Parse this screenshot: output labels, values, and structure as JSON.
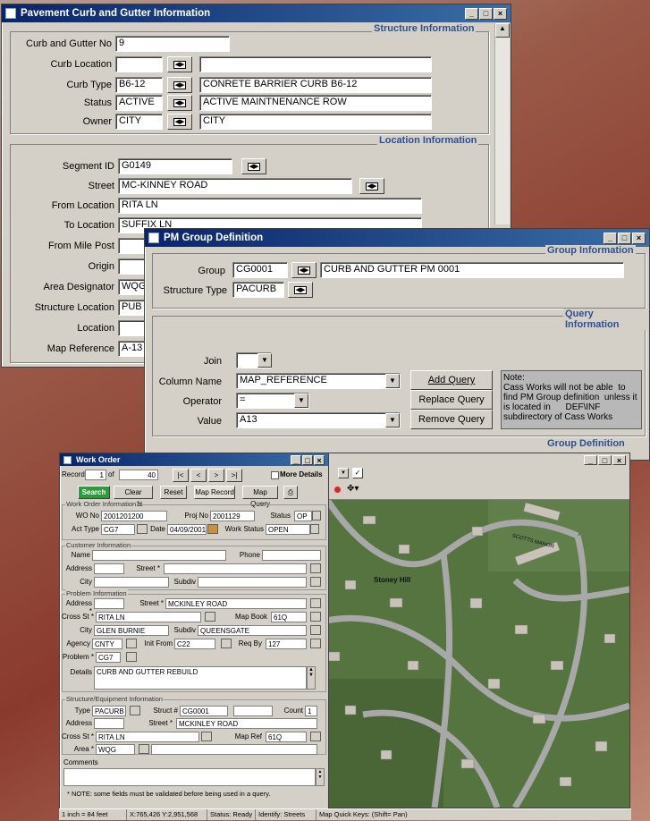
{
  "curb": {
    "title": "Pavement Curb and Gutter Information",
    "structure_info": "Structure Information",
    "location_info": "Location Information",
    "curb_gutter_no_label": "Curb and Gutter No",
    "curb_gutter_no": "9",
    "curb_location_label": "Curb Location",
    "curb_location": "",
    "curb_location_desc": "",
    "curb_type_label": "Curb Type",
    "curb_type": "B6-12",
    "curb_type_desc": "CONRETE BARRIER CURB B6-12",
    "status_label": "Status",
    "status": "ACTIVE",
    "status_desc": "ACTIVE MAINTNENANCE ROW",
    "owner_label": "Owner",
    "owner": "CITY",
    "owner_desc": "CITY",
    "segment_id_label": "Segment ID",
    "segment_id": "G0149",
    "street_label": "Street",
    "street": "MC-KINNEY ROAD",
    "from_location_label": "From Location",
    "from_location": "RITA LN",
    "to_location_label": "To Location",
    "to_location": "SUFFIX LN",
    "from_mile_post_label": "From Mile Post",
    "from_mile_post": "",
    "origin_label": "Origin",
    "origin": "",
    "area_designator_label": "Area Designator",
    "area_designator": "WQG",
    "structure_location_label": "Structure Location",
    "structure_location": "PUB",
    "location_label": "Location",
    "location": "",
    "map_reference_label": "Map Reference",
    "map_reference": "A-13"
  },
  "pm": {
    "title": "PM Group Definition",
    "group_info": "Group Information",
    "query_info": "Query Information",
    "group_def": "Group Definition",
    "group_label": "Group",
    "group": "CG0001",
    "group_desc": "CURB AND GUTTER PM 0001",
    "structure_type_label": "Structure Type",
    "structure_type": "PACURB",
    "join_label": "Join",
    "join": "",
    "column_name_label": "Column Name",
    "column_name": "MAP_REFERENCE",
    "operator_label": "Operator",
    "operator": "=",
    "value_label": "Value",
    "value": "A13",
    "add_query": "Add Query",
    "replace_query": "Replace Query",
    "remove_query": "Remove Query",
    "note": "Note:\nCass Works will not be able  to find PM Group definition  unless it is located in      DEF\\INF subdirectory of Cass Works"
  },
  "wo": {
    "title": "Work Order",
    "record_label": "Record",
    "record": "1",
    "of_label": "of",
    "record_total": "40",
    "nav": [
      "|<",
      "<",
      ">",
      ">|"
    ],
    "more_details": "More Details",
    "search": "Search",
    "clear_fields": "Clear Fields",
    "reset": "Reset",
    "map_record": "Map Record",
    "map_query": "Map Query",
    "sec_wo_info": "Work Order Information",
    "wo_no_label": "WO No",
    "wo_no": "2001201200",
    "proj_no_label": "Proj No",
    "proj_no": "2001129",
    "status_label": "Status",
    "status": "OP",
    "act_type_label": "Act Type",
    "act_type": "CG7",
    "date_label": "Date",
    "date": "04/09/2001",
    "work_status_label": "Work Status",
    "work_status": "OPEN",
    "sec_customer": "Customer Information",
    "name_label": "Name",
    "phone_label": "Phone",
    "address_label": "Address",
    "street_label": "Street *",
    "city_label": "City",
    "subdiv_label": "Subdiv",
    "sec_problem": "Problem Information",
    "p_address_label": "Address *",
    "p_street": "MCKINLEY ROAD",
    "cross_st_label": "Cross St *",
    "cross_st": "RITA LN",
    "map_book_label": "Map Book",
    "map_book": "61Q",
    "p_city": "GLEN BURNIE",
    "p_subdiv": "QUEENSGATE",
    "agency_label": "Agency",
    "agency": "CNTY",
    "init_from_label": "Init From",
    "init_from": "C22",
    "req_by_label": "Req By",
    "req_by": "127",
    "problem_label": "Problem *",
    "problem": "CG7",
    "details_label": "Details",
    "details": "CURB AND GUTTER REBUILD",
    "sec_structure": "Structure/Equipment Information",
    "type_label": "Type",
    "type": "PACURB",
    "struct_label": "Struct #",
    "struct": "CG0001",
    "count_label": "Count",
    "count": "1",
    "s_street_label": "Street *",
    "s_street": "MCKINLEY ROAD",
    "s_cross": "RITA LN",
    "map_ref_label": "Map Ref",
    "map_ref": "61Q",
    "area_label": "Area *",
    "area": "WQG",
    "comments_label": "Comments",
    "note": "* NOTE: some fields must be validated before being used in a query.",
    "status_scale": "1 inch = 84 feet",
    "status_coords": "X:765,426  Y:2,951,568",
    "status_ready": "Status: Ready",
    "status_identify": "Identify: Streets",
    "status_keys": "Map Quick Keys: (Shift= Pan)"
  },
  "map": {
    "place_label": "Stoney Hill",
    "road_label": "SCOTTS MANOR"
  }
}
